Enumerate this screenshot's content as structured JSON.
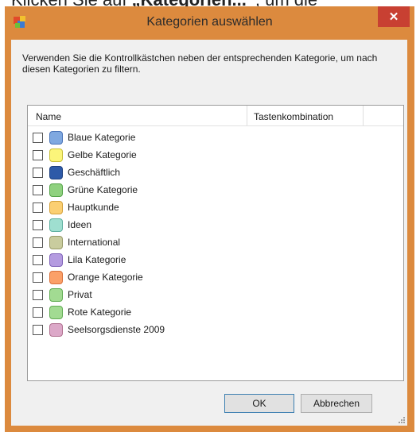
{
  "background": {
    "text_before": "Klicken Sie auf ",
    "text_bold": "„Kategorien...“",
    "text_after": ", um die"
  },
  "dialog": {
    "title": "Kategorien auswählen",
    "close_glyph": "✕",
    "description": "Verwenden Sie die Kontrollkästchen neben der entsprechenden Kategorie, um nach diesen Kategorien zu filtern.",
    "columns": {
      "name": "Name",
      "shortcut": "Tastenkombination"
    },
    "categories": [
      {
        "label": "Blaue Kategorie",
        "color": "#7fa8e0",
        "border": "#4a74b8",
        "checked": false
      },
      {
        "label": "Gelbe Kategorie",
        "color": "#fbf57a",
        "border": "#c8bf38",
        "checked": false
      },
      {
        "label": "Geschäftlich",
        "color": "#2e5aa8",
        "border": "#1d3f7e",
        "checked": false
      },
      {
        "label": "Grüne Kategorie",
        "color": "#8fd17f",
        "border": "#54a348",
        "checked": false
      },
      {
        "label": "Hauptkunde",
        "color": "#fbcf72",
        "border": "#d4a03a",
        "checked": false
      },
      {
        "label": "Ideen",
        "color": "#9fdfd0",
        "border": "#5fb0a0",
        "checked": false
      },
      {
        "label": "International",
        "color": "#c9cc9e",
        "border": "#989a68",
        "checked": false
      },
      {
        "label": "Lila Kategorie",
        "color": "#b49be0",
        "border": "#7f62b8",
        "checked": false
      },
      {
        "label": "Orange Kategorie",
        "color": "#fba068",
        "border": "#d8703a",
        "checked": false
      },
      {
        "label": "Privat",
        "color": "#a2db92",
        "border": "#62ac54",
        "checked": false
      },
      {
        "label": "Rote Kategorie",
        "color": "#a2db92",
        "border": "#62ac54",
        "checked": false
      },
      {
        "label": "Seelsorgsdienste 2009",
        "color": "#dca8c8",
        "border": "#b0708f",
        "checked": false
      }
    ],
    "buttons": {
      "ok": "OK",
      "cancel": "Abbrechen"
    }
  }
}
